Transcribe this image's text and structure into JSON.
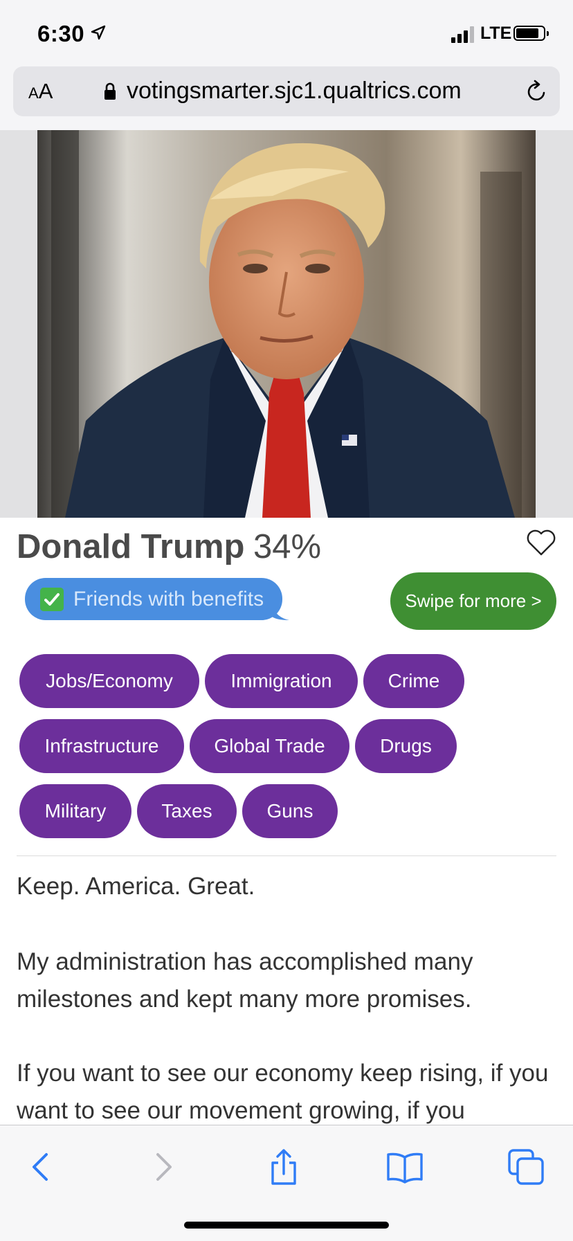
{
  "status_bar": {
    "time": "6:30",
    "network": "LTE"
  },
  "address_bar": {
    "aa_small": "A",
    "aa_large": "A",
    "url": "votingsmarter.sjc1.qualtrics.com"
  },
  "candidate": {
    "name": "Donald Trump",
    "match_percent": "34%",
    "badge_text": "Friends with benefits",
    "swipe_label": "Swipe for more >"
  },
  "tags": [
    "Jobs/Economy",
    "Immigration",
    "Crime",
    "Infrastructure",
    "Global Trade",
    "Drugs",
    "Military",
    "Taxes",
    "Guns"
  ],
  "body": {
    "p1": "Keep. America. Great.",
    "p2": "My administration has accomplished many milestones and kept many more promises.",
    "p3": "If you want to see our economy keep rising, if you want to see our movement growing, if you"
  },
  "colors": {
    "tag_purple": "#6c2f9b",
    "swipe_green": "#3f8f33",
    "bubble_blue": "#4a8ee0",
    "ios_blue": "#2f7cf6"
  },
  "icons": [
    "location-arrow-icon",
    "signal-icon",
    "battery-icon",
    "lock-icon",
    "reload-icon",
    "heart-icon",
    "check-icon",
    "back-icon",
    "forward-icon",
    "share-icon",
    "bookmarks-icon",
    "tabs-icon"
  ]
}
